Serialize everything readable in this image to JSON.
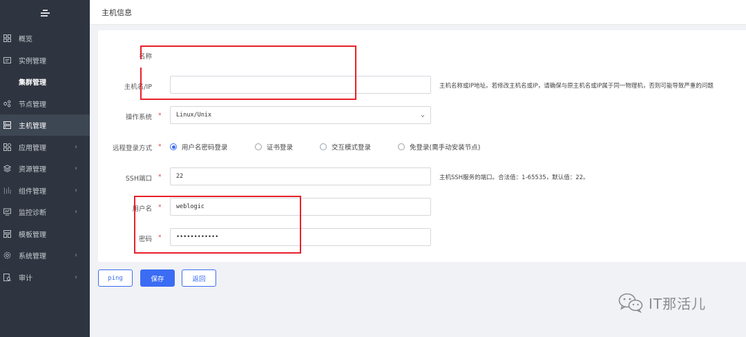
{
  "sidebar": {
    "items": [
      {
        "label": "概览",
        "icon": "dashboard-grid-icon",
        "chevron": false
      },
      {
        "label": "实例管理",
        "icon": "instance-list-icon",
        "chevron": false
      },
      {
        "label": "集群管理",
        "icon": "",
        "chevron": false
      },
      {
        "label": "节点管理",
        "icon": "node-icon",
        "chevron": false
      },
      {
        "label": "主机管理",
        "icon": "server-icon",
        "chevron": false
      },
      {
        "label": "应用管理",
        "icon": "app-grid-icon",
        "chevron": true
      },
      {
        "label": "资源管理",
        "icon": "layers-icon",
        "chevron": true
      },
      {
        "label": "组件管理",
        "icon": "component-icon",
        "chevron": true
      },
      {
        "label": "监控诊断",
        "icon": "monitor-icon",
        "chevron": true
      },
      {
        "label": "模板管理",
        "icon": "template-icon",
        "chevron": false
      },
      {
        "label": "系统管理",
        "icon": "settings-icon",
        "chevron": true
      },
      {
        "label": "审计",
        "icon": "audit-icon",
        "chevron": true
      }
    ],
    "chevron_glyph": "›"
  },
  "header": {
    "title": "主机信息"
  },
  "form": {
    "name_label": "名称",
    "host_label": "主机名/IP",
    "host_hint": "主机名称或IP地址。若修改主机名或IP，请确保与原主机名或IP属于同一物理机，否则可能导致严重的问题",
    "os_label": "操作系统",
    "os_value": "Linux/Unix",
    "login_label": "远程登录方式",
    "login_options": [
      "用户名密码登录",
      "证书登录",
      "交互模式登录",
      "免登录(需手动安装节点)"
    ],
    "ssh_label": "SSH端口",
    "ssh_value": "22",
    "ssh_hint": "主机SSH服务的端口。合法值：1-65535，默认值：22。",
    "user_label": "用户名",
    "user_value": "weblogic",
    "pwd_label": "密码",
    "pwd_value": "••••••••••••",
    "required_mark": "*"
  },
  "buttons": {
    "ping": "ping",
    "save": "保存",
    "back": "返回"
  },
  "watermark": {
    "text": "IT那活儿"
  },
  "colors": {
    "accent": "#3a6cf4",
    "sidebar_bg": "#2f3540",
    "annotation": "#e8202a"
  }
}
